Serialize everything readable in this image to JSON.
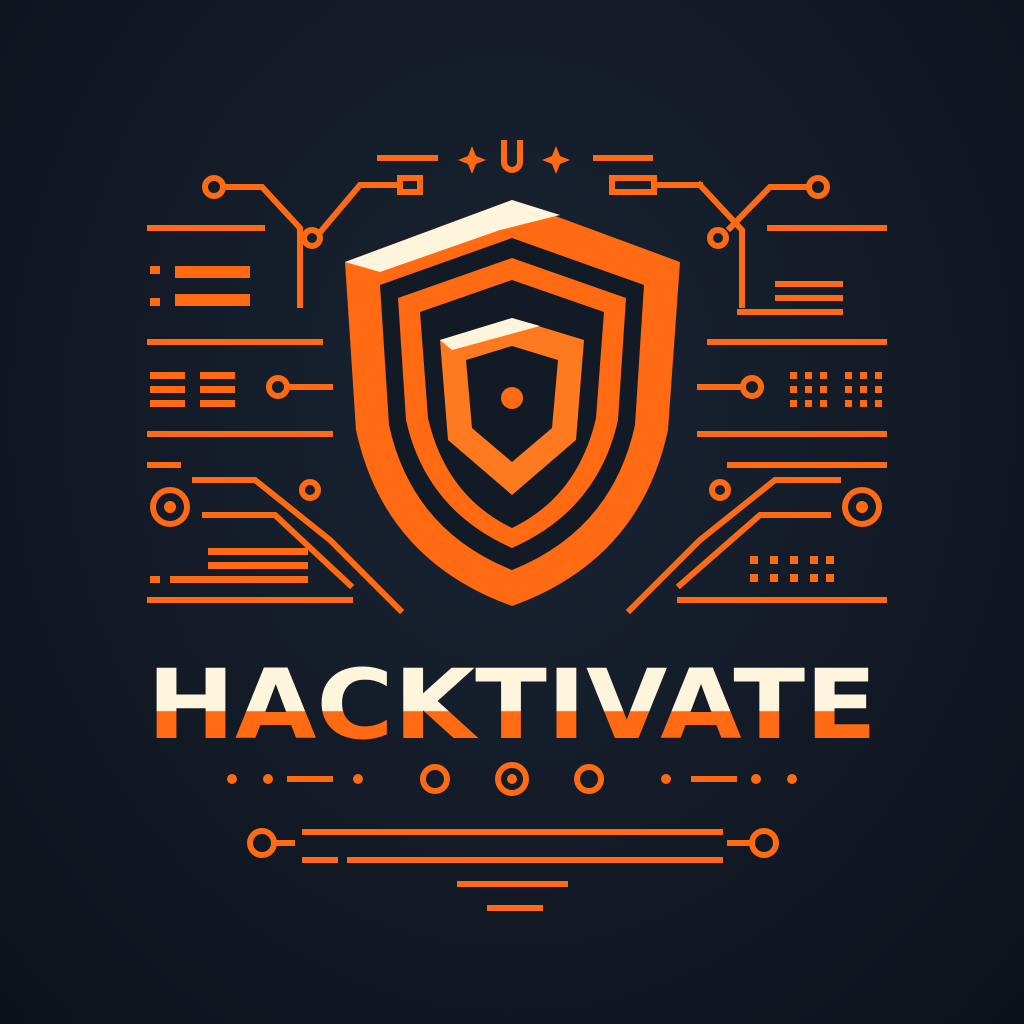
{
  "brand": {
    "wordmark": "HACKTIVATE",
    "top_mark": "+ U +"
  },
  "colors": {
    "accent": "#ff6a13",
    "accent_light": "#ff8a2a",
    "cream": "#fff4dc",
    "background": "#121a26"
  },
  "icons": {
    "center": "shield-icon",
    "decor": "circuit-lines"
  }
}
